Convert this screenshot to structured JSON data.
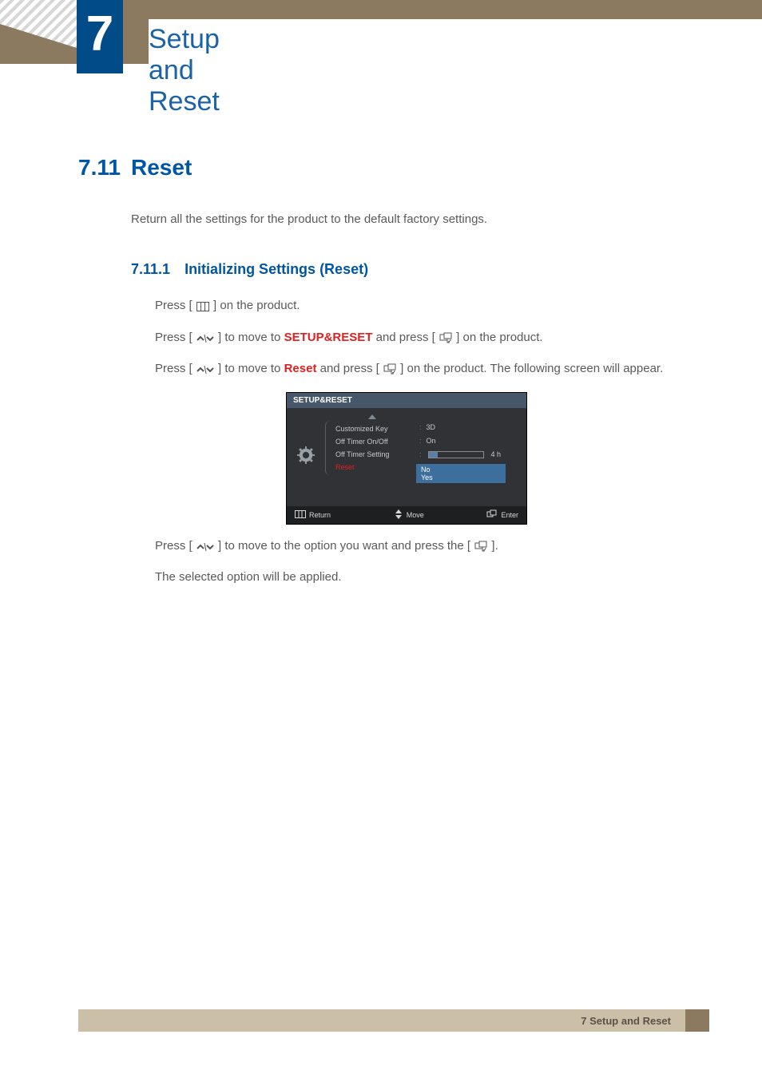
{
  "chapter": {
    "number": "7",
    "title": "Setup and Reset"
  },
  "section": {
    "number": "7.11",
    "title": "Reset",
    "intro": "Return all the settings for the product to the default factory settings."
  },
  "subsection": {
    "number": "7.11.1",
    "title": "Initializing Settings (Reset)"
  },
  "steps": {
    "s1a": "Press [",
    "s1b": "] on the product.",
    "s2a": "Press [",
    "s2b": "] to move to ",
    "s2hl": "SETUP&RESET",
    "s2c": " and press [",
    "s2d": "] on the product.",
    "s3a": "Press [",
    "s3b": "] to move to ",
    "s3hl": "Reset",
    "s3c": " and press [",
    "s3d": "] on the product. The following screen will appear.",
    "s4a": "Press [",
    "s4b": "] to move to the option you want and press the [",
    "s4c": "].",
    "s5": "The selected option will be applied."
  },
  "osd": {
    "title": "SETUP&RESET",
    "rows": {
      "r0": "Customized Key",
      "r1": "Off Timer On/Off",
      "r2": "Off Timer Setting",
      "r3": "Reset"
    },
    "vals": {
      "v0": "3D",
      "v1": "On",
      "slider_label": "4 h",
      "opt0": "No",
      "opt1": "Yes"
    },
    "bottom": {
      "return": "Return",
      "move": "Move",
      "enter": "Enter"
    }
  },
  "footer": {
    "text": "7 Setup and Reset"
  }
}
